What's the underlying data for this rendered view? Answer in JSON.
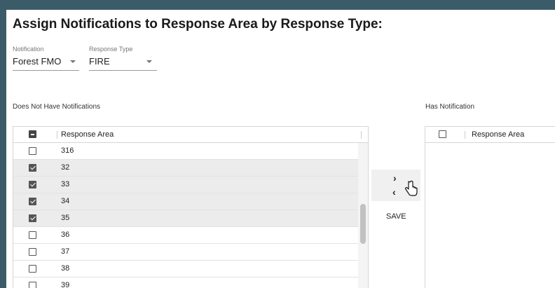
{
  "page": {
    "title": "Assign Notifications to Response Area by Response Type:"
  },
  "filters": {
    "notification": {
      "label": "Notification",
      "value": "Forest FMO"
    },
    "response_type": {
      "label": "Response Type",
      "value": "FIRE"
    }
  },
  "left_list": {
    "section_label": "Does Not Have Notifications",
    "column_header": "Response Area",
    "header_checkbox_state": "indeterminate",
    "rows": [
      {
        "value": "316",
        "checked": false
      },
      {
        "value": "32",
        "checked": true
      },
      {
        "value": "33",
        "checked": true
      },
      {
        "value": "34",
        "checked": true
      },
      {
        "value": "35",
        "checked": true
      },
      {
        "value": "36",
        "checked": false
      },
      {
        "value": "37",
        "checked": false
      },
      {
        "value": "38",
        "checked": false
      },
      {
        "value": "39",
        "checked": false
      }
    ]
  },
  "right_list": {
    "section_label": "Has Notification",
    "column_header": "Response Area",
    "header_checkbox_state": "unchecked",
    "rows": []
  },
  "actions": {
    "move_right": "›",
    "move_left": "‹",
    "save_label": "SAVE"
  },
  "icons": {
    "move_right": "chevron-right-icon",
    "move_left": "chevron-left-icon",
    "cursor": "hand-pointer-icon",
    "dropdown": "caret-down-icon"
  },
  "colors": {
    "frame": "#3c5b69",
    "checkbox_checked": "#555555",
    "selected_row": "#ececec"
  }
}
